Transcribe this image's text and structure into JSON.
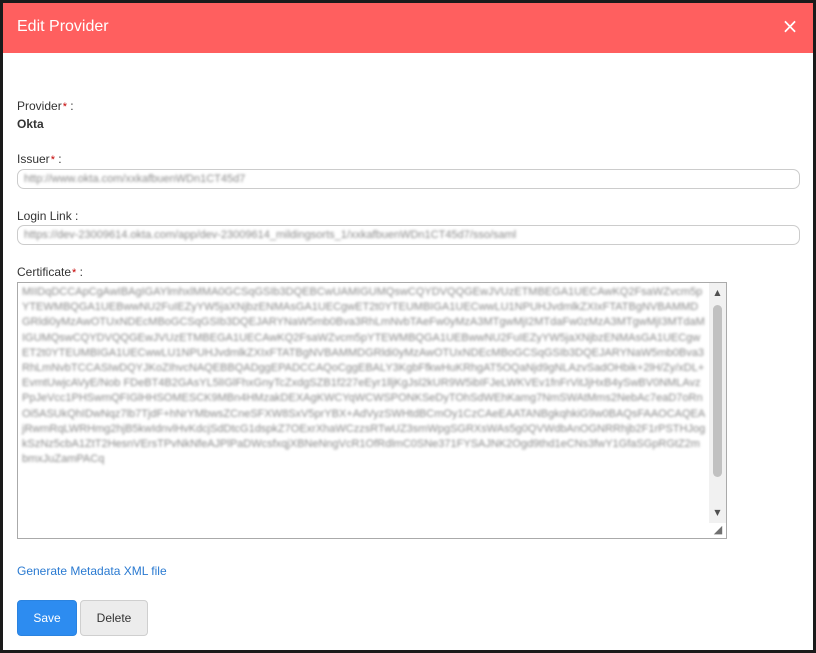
{
  "modal": {
    "title": "Edit Provider",
    "close_glyph": "×",
    "header_color": "#ff5f5f"
  },
  "provider": {
    "label": "Provider",
    "required_mark": "*",
    "suffix": " :",
    "value": "Okta"
  },
  "issuer": {
    "label": "Issuer",
    "required_mark": "*",
    "suffix": " :",
    "value": "http://www.okta.com/xxkafbuenWDn1CT45d7"
  },
  "login_link": {
    "label": "Login Link :",
    "value": "https://dev-23009614.okta.com/app/dev-23009614_mildingsorts_1/xxkafbuenWDn1CT45d7/sso/saml"
  },
  "certificate": {
    "label": "Certificate",
    "required_mark": "*",
    "suffix": " :",
    "value": "MIIDqDCCApCgAwIBAgIGAYlmhxlMMA0GCSqGSIb3DQEBCwUAMIGUMQswCQYDVQQGEwJVUzETMBEGA1UECAwKQ2FsaWZvcm5pYTEWMBQGA1UEBwwNU2FuIEZyYW5jaXNjbzENMAsGA1UECgwET2t0YTEUMBIGA1UECwwLU1NPUHJvdmlkZXIxFTATBgNVBAMMDGRldi0yMzAwOTUxNDEcMBoGCSqGSIb3DQEJARYNaW5mb0Bva3RhLmNvbTAeFw0yMzA3MTgwMjI2MTdaFw0zMzA3MTgwMjI3MTdaMIGUMQswCQYDVQQGEwJVUzETMBEGA1UECAwKQ2FsaWZvcm5pYTEWMBQGA1UEBwwNU2FuIEZyYW5jaXNjbzENMAsGA1UECgwET2t0YTEUMBIGA1UECwwLU1NPUHJvdmlkZXIxFTATBgNVBAMMDGRldi0yMzAwOTUxNDEcMBoGCSqGSIb3DQEJARYNaW5mb0Bva3RhLmNvbTCCASIwDQYJKoZIhvcNAQEBBQADggEPADCCAQoCggEBALY3KgbFfkwHuKRhgAT5OQaNjd9gNLAzvSadOHbik+2lH/Zy/xDL+EvmtUwjcAVyE/Nob FDeBT4B2GAsYL5lIGlFhxGnyTcZxdgSZB1f227eEyr1lljKgJsl2kUR9W5ibIFJeLWKVEv1fnFrVitJjHxB4ySwBV0NMLAvzPpJeVcc1PHSwmQFIGlHHSOMESCK9MBn4HMzakDEXAgKWCYqWCWSPONKSeDyTOhSdWEhKamg7NmSWAtMms2NebAc7eaD7oRnOi5ASUkQhIDwNqz7lb7TjdF+hNrYMbwsZCneSFXW8SxV5prYBX+AdVyzSWHtdBCmOy1CzCAeEAATANBgkqhkiG9w0BAQsFAAOCAQEAjRwmRqLWRHmg2hjB5kwIdnvlHvKdcjSdDtcG1dspkZ7OExrXhaWCzzsRTwUZ3smWpgSGRXsWAs5g0QVWdbAnOGNRRhjb2F1rPSTHJogkSzNz5cbA1ZtT2HesnVErsTPvNkNfeAJPlPaDWcsfxqjXBNeNngVcR1OfRdlmC0SNe371FYSAJNK2Ogd9thd1eCNs3fwY1GfaSGpRGtZ2mbmxJuZamPACq"
  },
  "links": {
    "generate_metadata": "Generate Metadata XML file"
  },
  "buttons": {
    "save": "Save",
    "delete": "Delete"
  },
  "colors": {
    "accent": "#2d8cf0",
    "link": "#2a7ad1",
    "required": "#c40000"
  }
}
